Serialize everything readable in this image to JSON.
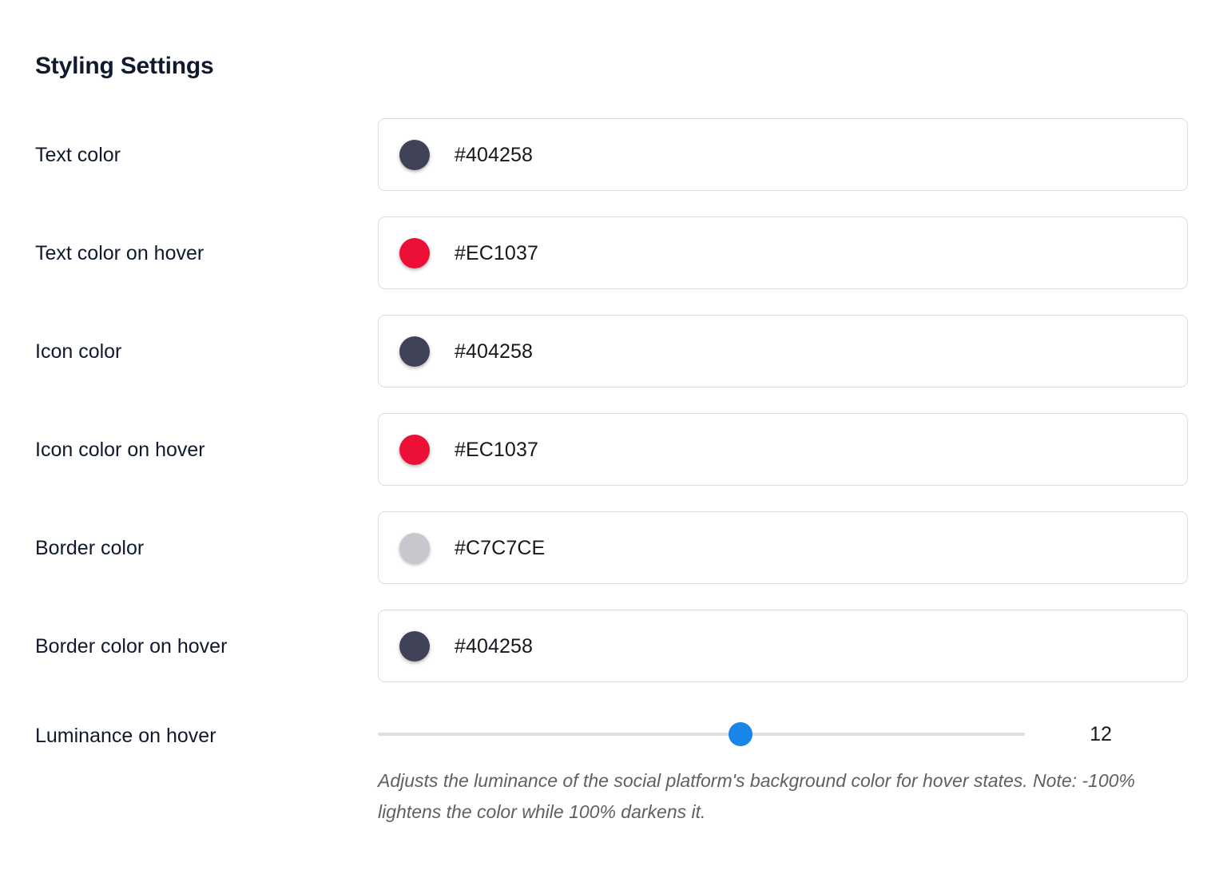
{
  "header": {
    "title": "Styling Settings"
  },
  "settings": {
    "color_rows": [
      {
        "label": "Text color",
        "value": "#404258",
        "swatch": "#404258"
      },
      {
        "label": "Text color on hover",
        "value": "#EC1037",
        "swatch": "#EC1037"
      },
      {
        "label": "Icon color",
        "value": "#404258",
        "swatch": "#404258"
      },
      {
        "label": "Icon color on hover",
        "value": "#EC1037",
        "swatch": "#EC1037"
      },
      {
        "label": "Border color",
        "value": "#C7C7CE",
        "swatch": "#C7C7CE"
      },
      {
        "label": "Border color on hover",
        "value": "#404258",
        "swatch": "#404258"
      }
    ],
    "luminance": {
      "label": "Luminance on hover",
      "value": "12",
      "min": -100,
      "max": 100,
      "thumb_color": "#1a85e8",
      "track_color": "#dfdfe1",
      "help_text": "Adjusts the luminance of the social platform's background color for hover states. Note: -100% lightens the color while 100% darkens it."
    }
  }
}
